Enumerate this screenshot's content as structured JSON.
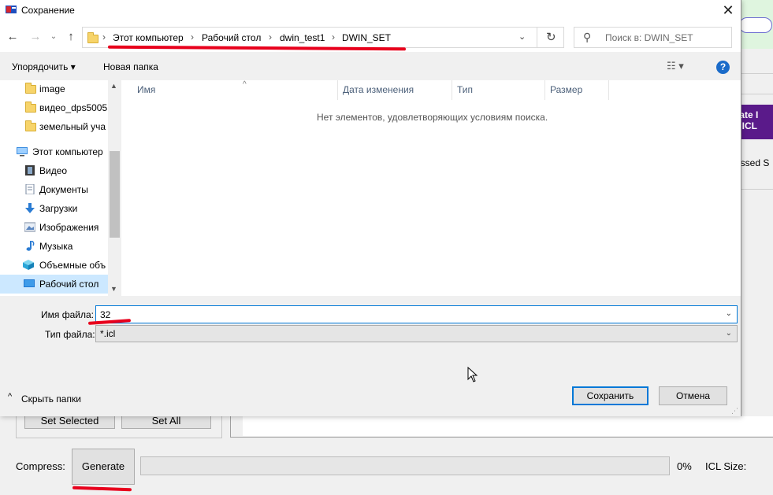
{
  "dialog": {
    "title": "Сохранение",
    "close_glyph": "✕",
    "nav": {
      "back_glyph": "←",
      "forward_glyph": "→",
      "recent_glyph": "⌄",
      "up_glyph": "↑"
    },
    "breadcrumb": [
      "Этот компьютер",
      "Рабочий стол",
      "dwin_test1",
      "DWIN_SET"
    ],
    "breadcrumb_sep": "›",
    "address_dropdown_glyph": "⌄",
    "refresh_glyph": "↻",
    "search": {
      "icon": "search-icon",
      "placeholder": "Поиск в: DWIN_SET"
    },
    "toolbar": {
      "organize": "Упорядочить ▾",
      "new_folder": "Новая папка",
      "view_glyph": "☷ ▾",
      "help_glyph": "?"
    },
    "sidebar": {
      "items": [
        {
          "label": "image",
          "icon": "folder-icon"
        },
        {
          "label": "видео_dps5005",
          "icon": "folder-icon"
        },
        {
          "label": "земельный уча",
          "icon": "folder-icon"
        },
        {
          "label": "Этот компьютер",
          "icon": "computer-icon"
        },
        {
          "label": "Видео",
          "icon": "video-icon"
        },
        {
          "label": "Документы",
          "icon": "documents-icon"
        },
        {
          "label": "Загрузки",
          "icon": "downloads-icon"
        },
        {
          "label": "Изображения",
          "icon": "pictures-icon"
        },
        {
          "label": "Музыка",
          "icon": "music-icon"
        },
        {
          "label": "Объемные объ",
          "icon": "3d-objects-icon"
        },
        {
          "label": "Рабочий стол",
          "icon": "desktop-icon",
          "selected": true
        }
      ],
      "scroll_up_glyph": "▲",
      "scroll_down_glyph": "▼"
    },
    "columns": [
      "Имя",
      "Дата изменения",
      "Тип",
      "Размер"
    ],
    "sort_glyph": "^",
    "empty_message": "Нет элементов, удовлетворяющих условиям поиска.",
    "filename_label": "Имя файла:",
    "filename_value": "32",
    "filetype_label": "Тип файла:",
    "filetype_value": "*.icl",
    "dropdown_glyph": "⌄",
    "hide_folders": "Скрыть папки",
    "hide_folders_glyph": "^",
    "save_button": "Сохранить",
    "cancel_button": "Отмена",
    "grip_glyph": "⋰"
  },
  "background_app": {
    "purple_button_line1": "erate I",
    "purple_button_line2": "to ICL",
    "compressed_text": "ressed S",
    "set_selected": "Set Selected",
    "set_all": "Set All",
    "compress_label": "Compress:",
    "generate_icl": "Generate ICL",
    "progress_percent": "0%",
    "progress_value": 0,
    "icl_size_label": "ICL Size:"
  },
  "colors": {
    "accent": "#0078d7",
    "annotation_red": "#e8001c",
    "selection": "#cce8ff",
    "purple_button": "#5a1a8a"
  }
}
